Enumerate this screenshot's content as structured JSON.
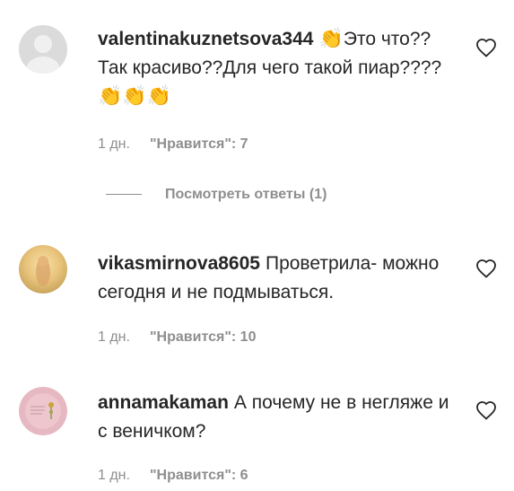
{
  "comments": [
    {
      "username": "valentinakuznetsova344",
      "emoji_before": "👏",
      "text": "Это что?? Так красиво??Для чего такой пиар????",
      "emoji_after": "👏👏👏",
      "time": "1 дн.",
      "likes": "\"Нравится\": 7",
      "replies": "Посмотреть ответы (1)"
    },
    {
      "username": "vikasmirnova8605",
      "text": "Проветрила- можно сегодня и не подмываться.",
      "time": "1 дн.",
      "likes": "\"Нравится\": 10"
    },
    {
      "username": "annamakaman",
      "text": "А почему не в негляже и с веничком?",
      "time": "1 дн.",
      "likes": "\"Нравится\": 6"
    }
  ],
  "icons": {
    "heart": "heart-outline-icon",
    "avatar_default": "default-avatar-icon"
  },
  "colors": {
    "text": "#262626",
    "secondary": "#8e8e8e",
    "background": "#ffffff"
  }
}
